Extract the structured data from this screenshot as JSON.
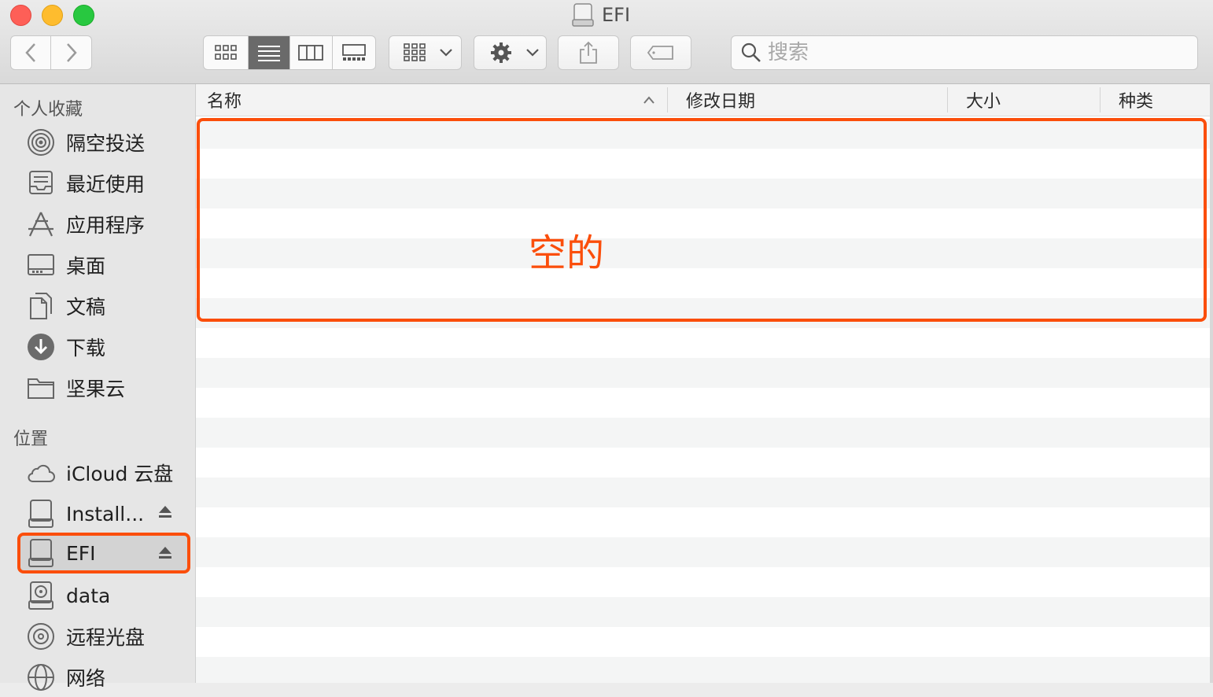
{
  "window": {
    "title": "EFI"
  },
  "toolbar": {
    "back_label": "<",
    "forward_label": ">",
    "view_modes": [
      "icon-view",
      "list-view",
      "column-view",
      "gallery-view"
    ],
    "active_view": "list-view",
    "search_placeholder": "搜索"
  },
  "sidebar": {
    "favorites_title": "个人收藏",
    "favorites": [
      {
        "label": "隔空投送",
        "icon": "airdrop-icon"
      },
      {
        "label": "最近使用",
        "icon": "recents-icon"
      },
      {
        "label": "应用程序",
        "icon": "applications-icon"
      },
      {
        "label": "桌面",
        "icon": "desktop-icon"
      },
      {
        "label": "文稿",
        "icon": "documents-icon"
      },
      {
        "label": "下载",
        "icon": "downloads-icon"
      },
      {
        "label": "坚果云",
        "icon": "folder-icon"
      }
    ],
    "locations_title": "位置",
    "locations": [
      {
        "label": "iCloud 云盘",
        "icon": "icloud-icon"
      },
      {
        "label": "Install...",
        "icon": "disk-icon",
        "eject": true
      },
      {
        "label": "EFI",
        "icon": "disk-icon",
        "eject": true,
        "selected": true
      },
      {
        "label": "data",
        "icon": "hard-drive-icon"
      },
      {
        "label": "远程光盘",
        "icon": "optical-disc-icon"
      },
      {
        "label": "网络",
        "icon": "network-icon"
      }
    ]
  },
  "list": {
    "columns": [
      "名称",
      "修改日期",
      "大小",
      "种类"
    ],
    "sort_column": "名称",
    "empty_label": "空的"
  },
  "colors": {
    "annotation": "#fb4e0b",
    "selected_bg": "#d3d3d3"
  }
}
